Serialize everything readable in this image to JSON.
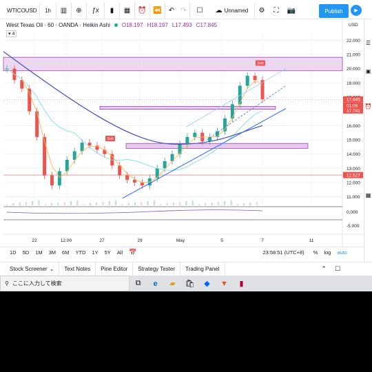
{
  "toolbar": {
    "symbol": "WTICOUSD",
    "interval": "1h",
    "unnamed": "Unnamed",
    "publish": "Publish"
  },
  "legend": {
    "title": "West Texas Oil · 60 · OANDA · Heikin Ashi",
    "o": "O18.197",
    "h": "H18.197",
    "l": "L17.493",
    "c": "C17.845",
    "study_count": "4"
  },
  "price_axis": {
    "currency": "USD",
    "ticks": [
      "22.000",
      "21.000",
      "20.000",
      "19.000",
      "18.000",
      "17.000",
      "16.000",
      "15.000",
      "14.000",
      "13.000",
      "12.000",
      "11.000"
    ],
    "last_price": "17.845",
    "countdown": "01:09",
    "ma_price": "17.741",
    "line_price": "12.527",
    "osc_ticks": [
      "0.000",
      "-5.000"
    ]
  },
  "time_axis": {
    "ticks": [
      "22",
      "12:00",
      "27",
      "29",
      "May",
      "5",
      "7",
      "11"
    ]
  },
  "signals": {
    "sell1": "Sell",
    "sell2": "Sell"
  },
  "ranges": [
    "1D",
    "5D",
    "1M",
    "3M",
    "6M",
    "YTD",
    "1Y",
    "5Y",
    "All"
  ],
  "clock": "23:58:51 (UTC+8)",
  "scale_opts": [
    "%",
    "log",
    "auto"
  ],
  "bottom_tabs": [
    "Stock Screener",
    "Text Notes",
    "Pine Editor",
    "Strategy Tester",
    "Trading Panel"
  ],
  "taskbar": {
    "search_placeholder": "ここに入力して検索"
  },
  "colors": {
    "accent": "#2196f3",
    "up": "#26a69a",
    "down": "#ef5350",
    "zone": "#e1bee7"
  },
  "chart_data": {
    "type": "candlestick",
    "title": "West Texas Oil · 60 · OANDA · Heikin Ashi",
    "ylim": [
      10.5,
      22.5
    ],
    "x_ticks": [
      "22",
      "12:00",
      "27",
      "29",
      "May",
      "5",
      "7",
      "11"
    ],
    "series": [
      {
        "name": "WTICOUSD",
        "close": [
          20.0,
          19.2,
          18.6,
          17.0,
          15.2,
          12.5,
          11.8,
          12.8,
          13.6,
          14.2,
          14.8,
          14.6,
          14.3,
          14.0,
          13.2,
          12.5,
          12.2,
          12.0,
          11.8,
          12.3,
          13.0,
          13.5,
          14.0,
          14.7,
          15.2,
          15.5,
          14.9,
          15.2,
          15.6,
          16.5,
          17.5,
          18.8,
          19.5,
          19.2,
          17.845
        ]
      }
    ]
  }
}
